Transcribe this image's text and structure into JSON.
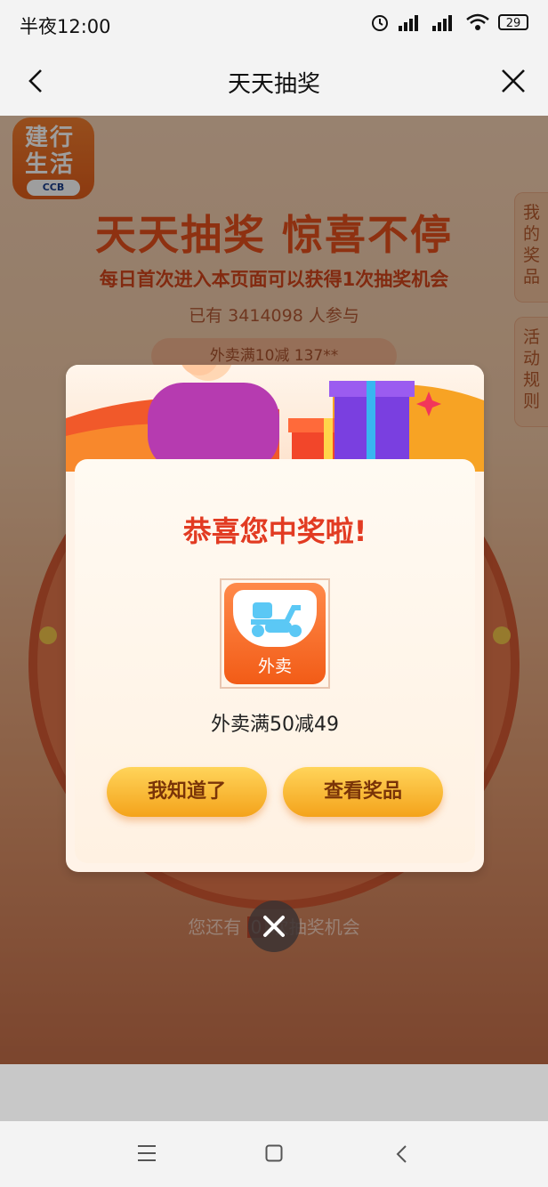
{
  "status_bar": {
    "time": "半夜12:00",
    "battery": "29"
  },
  "nav": {
    "title": "天天抽奖"
  },
  "app_logo": {
    "line1": "建行",
    "line2": "生活",
    "brand": "CCB"
  },
  "page": {
    "headline": "天天抽奖 惊喜不停",
    "subline": "每日首次进入本页面可以获得1次抽奖机会",
    "participants": "已有 3414098 人参与",
    "marquee": "外卖满10减  137**",
    "side_tabs": [
      {
        "label": "我的奖品"
      },
      {
        "label": "活动规则"
      }
    ],
    "remaining_prefix": "您还有",
    "remaining_count": "0",
    "remaining_suffix": "次抽奖机会"
  },
  "popup": {
    "title": "恭喜您中奖啦!",
    "prize_tag": "外卖",
    "prize_name": "外卖满50减49",
    "buttons": {
      "know": "我知道了",
      "view": "查看奖品"
    }
  },
  "colors": {
    "accent": "#e23b22",
    "button_gold": "#f4a31b",
    "prize_orange": "#f25c17"
  },
  "icons": {
    "back": "chevron-left-icon",
    "close": "close-icon",
    "dismiss": "close-circle-icon",
    "menu": "menu-icon",
    "home": "home-square-icon",
    "system_back": "back-triangle-icon"
  }
}
